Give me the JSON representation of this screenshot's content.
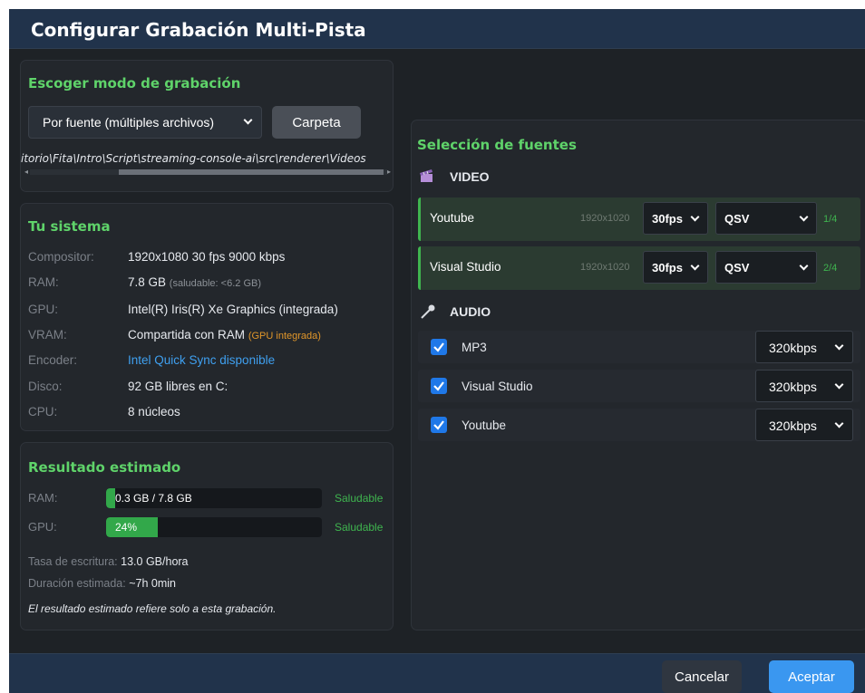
{
  "dialog": {
    "title": "Configurar Grabación Multi-Pista"
  },
  "mode": {
    "title": "Escoger modo de grabación",
    "selected": "Por fuente (múltiples archivos)",
    "folder_button": "Carpeta",
    "path": "itorio\\Fita\\Intro\\Script\\streaming-console-ai\\src\\renderer\\Videos"
  },
  "system": {
    "title": "Tu sistema",
    "rows": [
      {
        "label": "Compositor:",
        "value": "1920x1080 30 fps 9000 kbps"
      },
      {
        "label": "RAM:",
        "value": "7.8 GB",
        "note": "(saludable: <6.2 GB)"
      },
      {
        "label": "GPU:",
        "value": "Intel(R) Iris(R) Xe Graphics (integrada)"
      },
      {
        "label": "VRAM:",
        "value": "Compartida con RAM",
        "note": "(GPU integrada)"
      },
      {
        "label": "Encoder:",
        "value": "Intel Quick Sync disponible"
      },
      {
        "label": "Disco:",
        "value": "92 GB libres en C:"
      },
      {
        "label": "CPU:",
        "value": "8 núcleos"
      }
    ]
  },
  "estimate": {
    "title": "Resultado estimado",
    "ram": {
      "label": "RAM:",
      "text": "0.3 GB / 7.8 GB",
      "fraction": 0.04,
      "status": "Saludable"
    },
    "gpu": {
      "label": "GPU:",
      "text": "24%",
      "fraction": 0.24,
      "status": "Saludable"
    },
    "write_rate_label": "Tasa de escritura:",
    "write_rate": "13.0 GB/hora",
    "duration_label": "Duración estimada:",
    "duration": "~7h 0min",
    "note": "El resultado estimado refiere solo a esta grabación."
  },
  "sources": {
    "title": "Selección de fuentes",
    "video_header": "VIDEO",
    "video": [
      {
        "name": "Youtube",
        "resolution": "1920x1020",
        "fps": "30fps",
        "encoder": "QSV",
        "count": "1/4"
      },
      {
        "name": "Visual Studio",
        "resolution": "1920x1020",
        "fps": "30fps",
        "encoder": "QSV",
        "count": "2/4"
      }
    ],
    "audio_header": "AUDIO",
    "audio": [
      {
        "name": "MP3",
        "bitrate": "320kbps",
        "checked": true
      },
      {
        "name": "Visual Studio",
        "bitrate": "320kbps",
        "checked": true
      },
      {
        "name": "Youtube",
        "bitrate": "320kbps",
        "checked": true
      }
    ]
  },
  "footer": {
    "cancel": "Cancelar",
    "accept": "Aceptar"
  },
  "colors": {
    "accent_green": "#5fd36a",
    "primary_blue": "#3a97f0",
    "warning_orange": "#e0962a",
    "link_blue": "#3fa0f0"
  }
}
